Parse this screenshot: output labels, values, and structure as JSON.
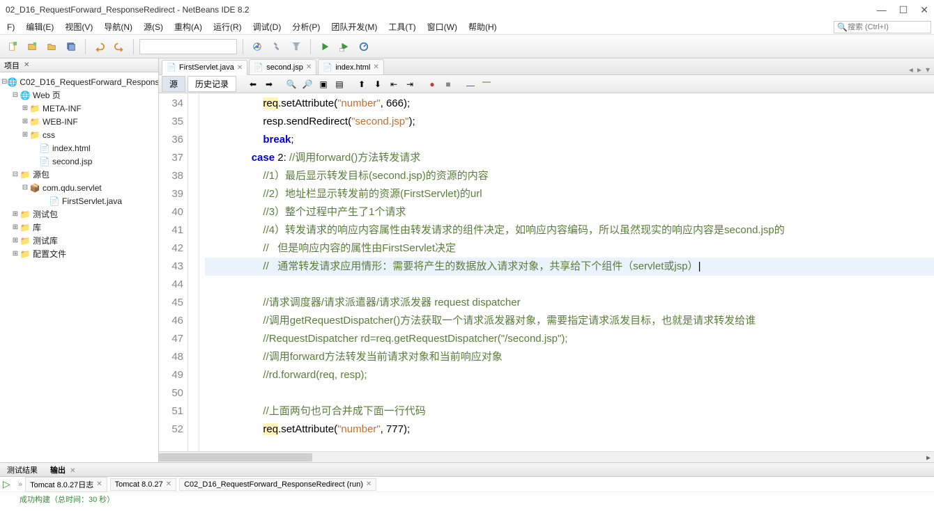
{
  "title": "02_D16_RequestForward_ResponseRedirect - NetBeans IDE 8.2",
  "window_buttons": {
    "min": "—",
    "max": "☐",
    "close": "✕"
  },
  "menu": {
    "items": [
      "F)",
      "编辑(E)",
      "视图(V)",
      "导航(N)",
      "源(S)",
      "重构(A)",
      "运行(R)",
      "调试(D)",
      "分析(P)",
      "团队开发(M)",
      "工具(T)",
      "窗口(W)",
      "帮助(H)"
    ],
    "search_placeholder": "搜索 (Ctrl+I)"
  },
  "project_tab": "项目",
  "tree": {
    "root": "C02_D16_RequestForward_Respons",
    "web": "Web 页",
    "metainf": "META-INF",
    "webinf": "WEB-INF",
    "css": "css",
    "index": "index.html",
    "second": "second.jsp",
    "srcpkg": "源包",
    "pkg": "com.qdu.servlet",
    "first": "FirstServlet.java",
    "testpkg": "测试包",
    "lib": "库",
    "testlib": "测试库",
    "config": "配置文件"
  },
  "file_tabs": [
    {
      "name": "FirstServlet.java",
      "active": true
    },
    {
      "name": "second.jsp",
      "active": false
    },
    {
      "name": "index.html",
      "active": false
    }
  ],
  "editor_toolbar": {
    "source": "源",
    "history": "历史记录"
  },
  "code": {
    "lines": [
      {
        "n": 34,
        "segs": [
          {
            "t": "                    "
          },
          {
            "t": "req",
            "c": "id-hl"
          },
          {
            "t": ".setAttribute("
          },
          {
            "t": "\"number\"",
            "c": "str"
          },
          {
            "t": ", 666);"
          }
        ]
      },
      {
        "n": 35,
        "segs": [
          {
            "t": "                    resp.sendRedirect("
          },
          {
            "t": "\"second.jsp\"",
            "c": "str"
          },
          {
            "t": ");"
          }
        ]
      },
      {
        "n": 36,
        "segs": [
          {
            "t": "                    "
          },
          {
            "t": "break",
            "c": "kw"
          },
          {
            "t": ";"
          }
        ]
      },
      {
        "n": 37,
        "segs": [
          {
            "t": "                "
          },
          {
            "t": "case",
            "c": "kw"
          },
          {
            "t": " 2: "
          },
          {
            "t": "//调用forward()方法转发请求",
            "c": "cm"
          }
        ]
      },
      {
        "n": 38,
        "segs": [
          {
            "t": "                    "
          },
          {
            "t": "//1）最后显示转发目标(second.jsp)的资源的内容",
            "c": "cm"
          }
        ]
      },
      {
        "n": 39,
        "segs": [
          {
            "t": "                    "
          },
          {
            "t": "//2）地址栏显示转发前的资源(FirstServlet)的url",
            "c": "cm"
          }
        ]
      },
      {
        "n": 40,
        "segs": [
          {
            "t": "                    "
          },
          {
            "t": "//3）整个过程中产生了1个请求",
            "c": "cm"
          }
        ]
      },
      {
        "n": 41,
        "segs": [
          {
            "t": "                    "
          },
          {
            "t": "//4）转发请求的响应内容属性由转发请求的组件决定，如响应内容编码，所以虽然现实的响应内容是second.jsp的",
            "c": "cm"
          }
        ]
      },
      {
        "n": 42,
        "segs": [
          {
            "t": "                    "
          },
          {
            "t": "//   但是响应内容的属性由FirstServlet决定",
            "c": "cm"
          }
        ]
      },
      {
        "n": 43,
        "hl": true,
        "segs": [
          {
            "t": "                    "
          },
          {
            "t": "//   通常转发请求应用情形：需要将产生的数据放入请求对象，共享给下个组件（servlet或jsp）",
            "c": "cm"
          },
          {
            "t": "|"
          }
        ]
      },
      {
        "n": 44,
        "segs": [
          {
            "t": " "
          }
        ]
      },
      {
        "n": 45,
        "segs": [
          {
            "t": "                    "
          },
          {
            "t": "//请求调度器/请求派遣器/请求派发器 request dispatcher",
            "c": "cm"
          }
        ]
      },
      {
        "n": 46,
        "segs": [
          {
            "t": "                    "
          },
          {
            "t": "//调用getRequestDispatcher()方法获取一个请求派发器对象，需要指定请求派发目标，也就是请求转发给谁",
            "c": "cm"
          }
        ]
      },
      {
        "n": 47,
        "segs": [
          {
            "t": "                    "
          },
          {
            "t": "//RequestDispatcher rd=req.getRequestDispatcher(\"/second.jsp\");",
            "c": "cm"
          }
        ]
      },
      {
        "n": 48,
        "segs": [
          {
            "t": "                    "
          },
          {
            "t": "//调用forward方法转发当前请求对象和当前响应对象",
            "c": "cm"
          }
        ]
      },
      {
        "n": 49,
        "segs": [
          {
            "t": "                    "
          },
          {
            "t": "//rd.forward(req, resp);",
            "c": "cm"
          }
        ]
      },
      {
        "n": 50,
        "segs": [
          {
            "t": " "
          }
        ]
      },
      {
        "n": 51,
        "segs": [
          {
            "t": "                    "
          },
          {
            "t": "//上面两句也可合并成下面一行代码",
            "c": "cm"
          }
        ]
      },
      {
        "n": 52,
        "segs": [
          {
            "t": "                    "
          },
          {
            "t": "req",
            "c": "id-hl"
          },
          {
            "t": ".setAttribute("
          },
          {
            "t": "\"number\"",
            "c": "str"
          },
          {
            "t": ", 777);"
          }
        ]
      }
    ]
  },
  "output": {
    "left_tab": "测试结果",
    "right_tab": "输出",
    "sub_tabs": [
      {
        "name": "Tomcat 8.0.27日志"
      },
      {
        "name": "Tomcat 8.0.27"
      },
      {
        "name": "C02_D16_RequestForward_ResponseRedirect (run)"
      }
    ],
    "body": "成功构建（总时间：30 秒）"
  }
}
